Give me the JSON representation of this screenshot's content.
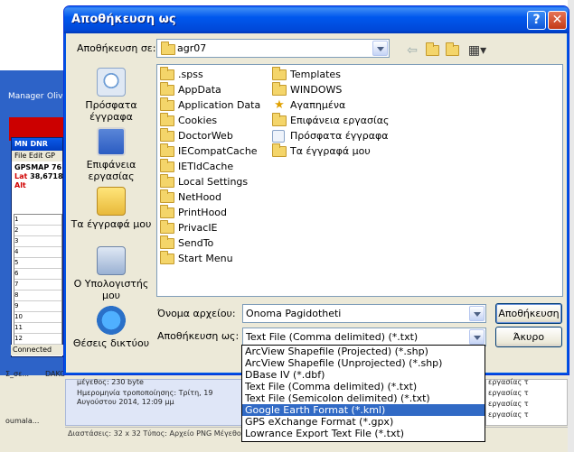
{
  "background": {
    "desktop_labels": [
      "Manager",
      "Olive"
    ],
    "mn_window": {
      "title": "MN DNR",
      "menu": "File  Edit  GP",
      "device": "GPSMAP 76",
      "lat_label": "Lat",
      "lat_value": "38,6718",
      "alt_label": "Alt",
      "grid_rows": [
        "1",
        "2",
        "3",
        "4",
        "5",
        "6",
        "7",
        "8",
        "9",
        "10",
        "11",
        "12"
      ],
      "status": "Connected"
    },
    "taskbar_items": [
      "Σ_σε...",
      "DAKO",
      "oumala..."
    ],
    "bottom_panel": {
      "size": "μέγεθος: 230 byte",
      "modified_label": "Ημερομηνία τροποποίησης: Τρίτη, 19",
      "modified_date": "Αυγούστου 2014, 12:09 μμ"
    },
    "right_panel_lines": [
      "εργασίας τ",
      "εργασίας τ",
      "εργασίας τ",
      "εργασίας τ"
    ],
    "status_text": "Διαστάσεις: 32 x 32 Τύπος: Αρχείο PNG Μέγεθος: 230 byte"
  },
  "dialog": {
    "title": "Αποθήκευση ως",
    "save_in_label": "Αποθήκευση σε:",
    "save_in_value": "agr07",
    "places": [
      {
        "label": "Πρόσφατα έγγραφα",
        "icon": "recent-documents-icon"
      },
      {
        "label": "Επιφάνεια εργασίας",
        "icon": "desktop-icon"
      },
      {
        "label": "Τα έγγραφά μου",
        "icon": "my-documents-icon"
      },
      {
        "label": "Ο Υπολογιστής μου",
        "icon": "my-computer-icon"
      },
      {
        "label": "Θέσεις δικτύου",
        "icon": "network-places-icon"
      }
    ],
    "files_col1": [
      ".spss",
      "AppData",
      "Application Data",
      "Cookies",
      "DoctorWeb",
      "IECompatCache",
      "IETldCache",
      "Local Settings",
      "NetHood",
      "PrintHood",
      "PrivacIE",
      "SendTo",
      "Start Menu"
    ],
    "files_col2": [
      "Templates",
      "WINDOWS",
      "Αγαπημένα",
      "Επιφάνεια εργασίας",
      "Πρόσφατα έγγραφα",
      "Τα έγγραφά μου"
    ],
    "filename_label": "Όνομα αρχείου:",
    "filename_value": "Onoma Pagidotheti",
    "savetype_label": "Αποθήκευση ως:",
    "savetype_value": "Text File (Comma delimited) (*.txt)",
    "save_button": "Αποθήκευση",
    "cancel_button": "Άκυρο",
    "type_options": [
      "ArcView Shapefile (Projected) (*.shp)",
      "ArcView Shapefile (Unprojected) (*.shp)",
      "DBase IV (*.dbf)",
      "Text File (Comma delimited) (*.txt)",
      "Text File (Semicolon delimited) (*.txt)",
      "Google Earth Format (*.kml)",
      "GPS eXchange Format (*.gpx)",
      "Lowrance Export Text File (*.txt)"
    ],
    "selected_option_index": 5
  }
}
